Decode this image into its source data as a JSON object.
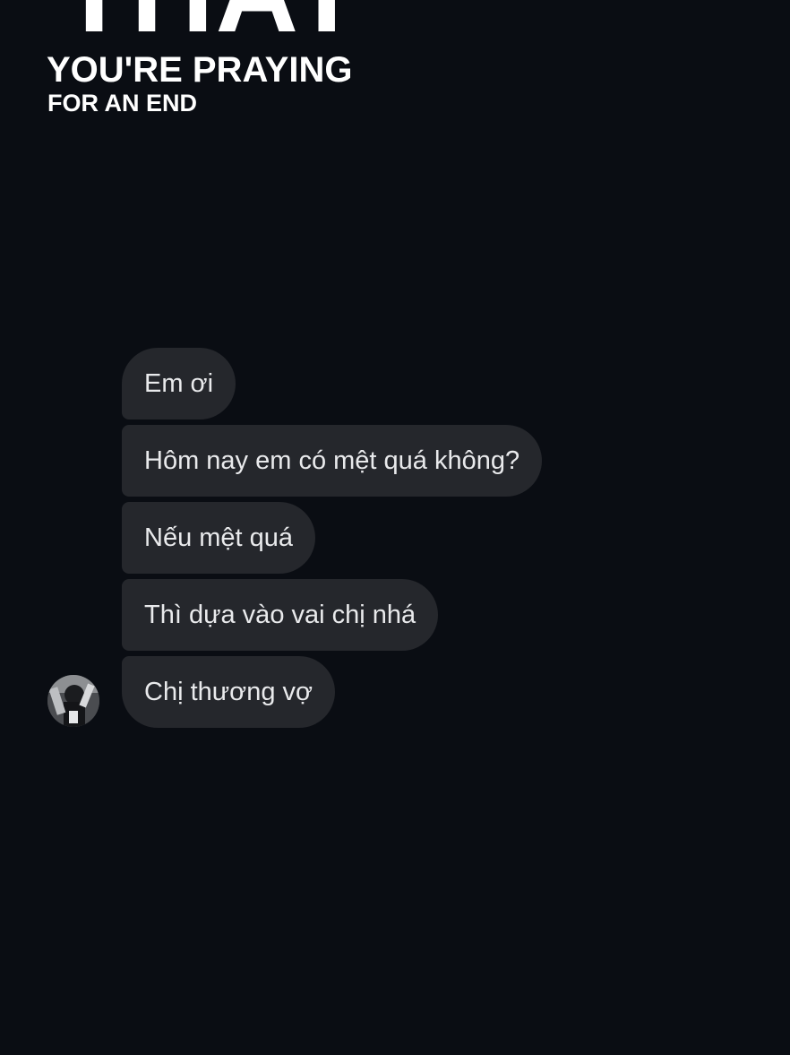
{
  "overlay": {
    "headline_big": "THAT",
    "headline_mid": "YOU'RE PRAYING",
    "headline_small": "FOR AN END"
  },
  "chat": {
    "messages": [
      "Em ơi",
      "Hôm nay em có mệt quá không?",
      "Nếu mệt quá",
      "Thì dựa vào vai chị nhá",
      "Chị thương vợ"
    ]
  },
  "colors": {
    "background": "#0a0d13",
    "bubble": "#25272c",
    "bubble_text": "#e9eaec",
    "overlay_text": "#ffffff"
  }
}
